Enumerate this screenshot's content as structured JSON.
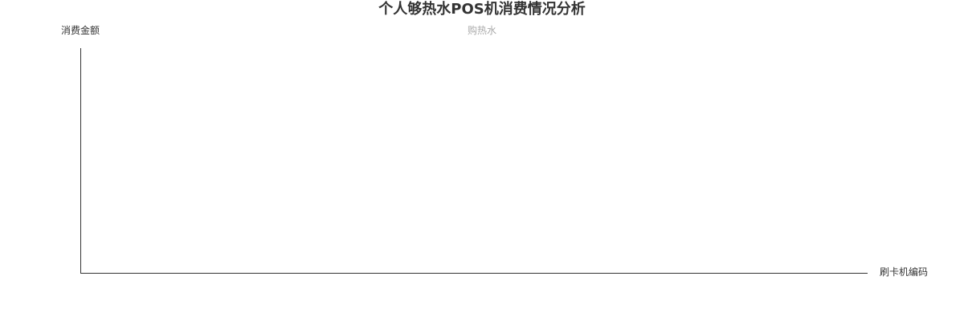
{
  "chart_data": {
    "type": "bar",
    "title": "个人够热水POS机消费情况分析",
    "xlabel": "刷卡机编码",
    "ylabel": "消费金额",
    "categories": [],
    "series": [
      {
        "name": "购热水",
        "values": []
      }
    ],
    "legend_position": "top-center",
    "grid": false
  },
  "colors": {
    "axis": "#333333",
    "title": "#333333",
    "legend_inactive": "#aaaaaa"
  }
}
